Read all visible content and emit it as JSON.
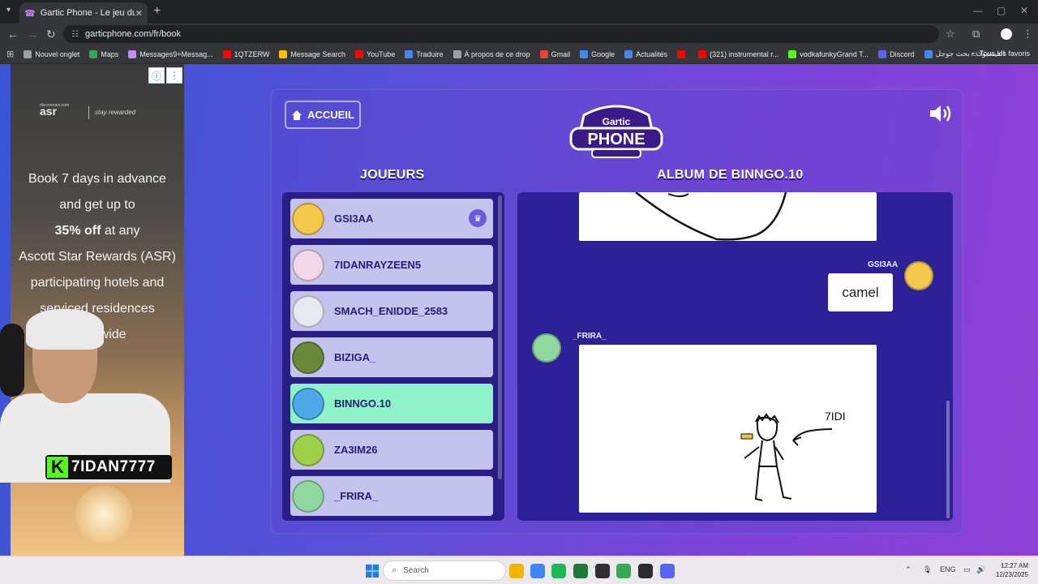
{
  "browser": {
    "tab_title": "Gartic Phone - Le jeu du téléph",
    "url": "garticphone.com/fr/book",
    "bookmarks": [
      {
        "label": "Nouvel onglet",
        "color": "#9aa0a6"
      },
      {
        "label": "Maps",
        "color": "#34a853"
      },
      {
        "label": "Messages9+Messag...",
        "color": "#c58af9"
      },
      {
        "label": "1QTZERW",
        "color": "#ff0000"
      },
      {
        "label": "Message Search",
        "color": "#fbbc04"
      },
      {
        "label": "YouTube",
        "color": "#ff0000"
      },
      {
        "label": "Traduire",
        "color": "#4285f4"
      },
      {
        "label": "À propos de ce drop",
        "color": "#9aa0a6"
      },
      {
        "label": "Gmail",
        "color": "#ea4335"
      },
      {
        "label": "Google",
        "color": "#4285f4"
      },
      {
        "label": "Actualités",
        "color": "#4285f4"
      },
      {
        "label": "",
        "color": "#ff0000"
      },
      {
        "label": "(321) instrumental r...",
        "color": "#ff0000"
      },
      {
        "label": "vodkafunkyGrand T...",
        "color": "#53fc18"
      },
      {
        "label": "Discord",
        "color": "#5865f2"
      },
      {
        "label": "الفيسبوك - بحث جوجل",
        "color": "#4285f4"
      }
    ],
    "all_bookmarks": "Tous les favoris"
  },
  "ad": {
    "logo_small": "discoverasr.com",
    "logo": "asr",
    "tagline": "stay rewarded",
    "line1": "Book 7 days in advance",
    "line2": "and get up to",
    "line3_bold": "35% off",
    "line3_rest": " at any",
    "line4": "Ascott Star Rewards (ASR)",
    "line5": "participating hotels and",
    "line6": "serviced residences",
    "line7": "worldwide"
  },
  "stream": {
    "kick_letter": "K",
    "channel": "7IDAN7777"
  },
  "game": {
    "home_label": "ACCUEIL",
    "logo_top": "Gartic",
    "logo_bottom": "PHONE",
    "players_title": "JOUEURS",
    "album_title_prefix": "ALBUM DE ",
    "album_owner": "BINNGO.10",
    "players": [
      {
        "name": "GSI3AA",
        "color": "#f4c84a",
        "host": true
      },
      {
        "name": "7IDANRAYZEEN5",
        "color": "#f3d6e8"
      },
      {
        "name": "SMACH_ENIDDE_2583",
        "color": "#e8e8f0"
      },
      {
        "name": "BIZIGA_",
        "color": "#6a8a3a"
      },
      {
        "name": "BINNGO.10",
        "color": "#4fa8e8",
        "active": true
      },
      {
        "name": "ZA3IM26",
        "color": "#9fd04a"
      },
      {
        "name": "_FRIRA_",
        "color": "#8fd9a0"
      }
    ],
    "crown_icon": "♛",
    "entries": [
      {
        "author": "GSI3AA",
        "guess": "camel"
      },
      {
        "author": "_FRIRA_",
        "drawing_note": "7IDI"
      }
    ]
  },
  "taskbar": {
    "search_placeholder": "Search",
    "lang": "ENG",
    "time": "12:27 AM",
    "date": "12/23/2025",
    "icons": [
      {
        "name": "files-icon",
        "color": "#f4b400"
      },
      {
        "name": "chrome-icon",
        "color": "#4285f4"
      },
      {
        "name": "spotify-icon",
        "color": "#1db954"
      },
      {
        "name": "app-green-icon",
        "color": "#1f7a3a"
      },
      {
        "name": "obs-icon",
        "color": "#302e31"
      },
      {
        "name": "chrome2-icon",
        "color": "#34a853"
      },
      {
        "name": "epic-icon",
        "color": "#2a2a2a"
      },
      {
        "name": "discord-icon",
        "color": "#5865f2"
      }
    ]
  }
}
